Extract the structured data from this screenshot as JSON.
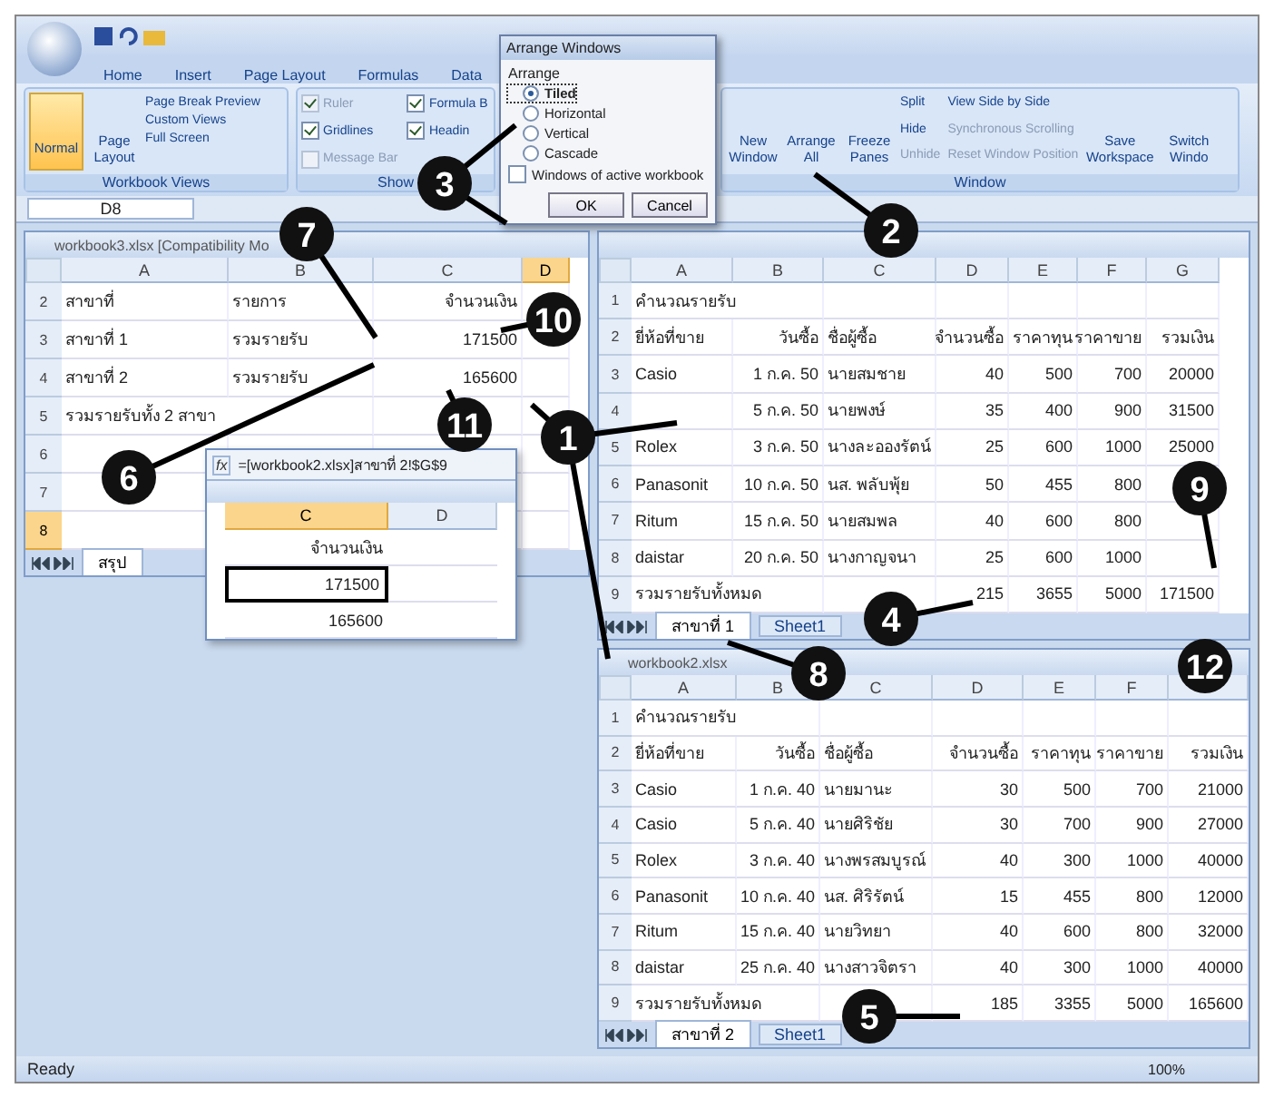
{
  "ribbon_tabs": [
    {
      "label": "Home",
      "selected": false
    },
    {
      "label": "Insert",
      "selected": false
    },
    {
      "label": "Page Layout",
      "selected": false
    },
    {
      "label": "Formulas",
      "selected": false
    },
    {
      "label": "Data",
      "selected": false
    }
  ],
  "workbook_views": {
    "label": "Workbook Views",
    "items": [
      {
        "label": "Normal",
        "selected": true
      },
      {
        "label": "Page Layout",
        "selected": false
      }
    ],
    "small": [
      "Page Break Preview",
      "Custom Views",
      "Full Screen"
    ]
  },
  "show_group": {
    "label": "Show",
    "items": [
      {
        "label": "Ruler",
        "checked": true,
        "disabled": true
      },
      {
        "label": "Gridlines",
        "checked": true,
        "disabled": false
      },
      {
        "label": "Message Bar",
        "checked": false,
        "disabled": true
      },
      {
        "label": "Formula B",
        "checked": true,
        "disabled": false
      },
      {
        "label": "Headin",
        "checked": true,
        "disabled": false
      }
    ]
  },
  "window_group": {
    "label": "Window",
    "large": [
      "New Window",
      "Arrange All",
      "Freeze Panes"
    ],
    "small": [
      {
        "label": "Split",
        "disabled": false
      },
      {
        "label": "Hide",
        "disabled": false
      },
      {
        "label": "Unhide",
        "disabled": true
      },
      {
        "label": "View Side by Side",
        "disabled": false
      },
      {
        "label": "Synchronous Scrolling",
        "disabled": true
      },
      {
        "label": "Reset Window Position",
        "disabled": true
      }
    ],
    "end": [
      "Save Workspace",
      "Switch Windo"
    ]
  },
  "name_box": "D8",
  "dialog": {
    "title": "Arrange Windows",
    "group": "Arrange",
    "options": [
      {
        "label": "Tiled",
        "selected": true
      },
      {
        "label": "Horizontal",
        "selected": false
      },
      {
        "label": "Vertical",
        "selected": false
      },
      {
        "label": "Cascade",
        "selected": false
      }
    ],
    "checkbox": {
      "label": "Windows of active workbook",
      "checked": false
    },
    "buttons": [
      "OK",
      "Cancel"
    ]
  },
  "sheets": [
    {
      "title": "workbook3.xlsx [Compatibility Mo",
      "columns": [
        {
          "label": "A",
          "selected": false
        },
        {
          "label": "B",
          "selected": false
        },
        {
          "label": "C",
          "selected": false
        },
        {
          "label": "D",
          "selected": true
        }
      ],
      "rows": [
        {
          "num": "2",
          "selected": false,
          "cells": {
            "A": "สาขาที่",
            "B": "รายการ",
            "C": "จำนวนเงิน"
          }
        },
        {
          "num": "3",
          "selected": false,
          "cells": {
            "A": "สาขาที่ 1",
            "B": "รวมรายรับ",
            "C": "171500"
          }
        },
        {
          "num": "4",
          "selected": false,
          "cells": {
            "A": "สาขาที่ 2",
            "B": "รวมรายรับ",
            "C": "165600"
          }
        },
        {
          "num": "5",
          "selected": false,
          "cells": {
            "A": "รวมรายรับทั้ง 2 สาขา"
          }
        },
        {
          "num": "6",
          "selected": false,
          "cells": {}
        },
        {
          "num": "7",
          "selected": false,
          "cells": {}
        },
        {
          "num": "8",
          "selected": true,
          "cells": {}
        }
      ],
      "tabs": [
        {
          "label": "สรุป",
          "selected": true
        }
      ]
    },
    {
      "columns": [
        {
          "label": "A",
          "selected": false
        },
        {
          "label": "B",
          "selected": false
        },
        {
          "label": "C",
          "selected": false
        },
        {
          "label": "D",
          "selected": false
        },
        {
          "label": "E",
          "selected": false
        },
        {
          "label": "F",
          "selected": false
        },
        {
          "label": "G",
          "selected": false
        }
      ],
      "rows": [
        {
          "num": "1",
          "selected": false,
          "cells": {
            "A": "คำนวณรายรับ"
          }
        },
        {
          "num": "2",
          "selected": false,
          "cells": {
            "A": "ยี่ห้อที่ขาย",
            "B": "วันซื้อ",
            "C": "ชื่อผู้ซื้อ",
            "D": "จำนวนซื้อ",
            "E": "ราคาทุน",
            "F": "ราคาขาย",
            "G": "รวมเงิน"
          }
        },
        {
          "num": "3",
          "selected": false,
          "cells": {
            "A": "Casio",
            "B": "1 ก.ค. 50",
            "C": "นายสมชาย",
            "D": "40",
            "E": "500",
            "F": "700",
            "G": "20000"
          }
        },
        {
          "num": "4",
          "selected": false,
          "cells": {
            "B": "5 ก.ค. 50",
            "C": "นายพงษ์",
            "D": "35",
            "E": "400",
            "F": "900",
            "G": "31500"
          }
        },
        {
          "num": "5",
          "selected": false,
          "cells": {
            "A": "Rolex",
            "B": "3 ก.ค. 50",
            "C": "นางละอองรัตน์",
            "D": "25",
            "E": "600",
            "F": "1000",
            "G": "25000"
          }
        },
        {
          "num": "6",
          "selected": false,
          "cells": {
            "A": "Panasonit",
            "B": "10 ก.ค. 50",
            "C": "นส. พลับพุ้ย",
            "D": "50",
            "E": "455",
            "F": "800"
          }
        },
        {
          "num": "7",
          "selected": false,
          "cells": {
            "A": "Ritum",
            "B": "15 ก.ค. 50",
            "C": "นายสมพล",
            "D": "40",
            "E": "600",
            "F": "800"
          }
        },
        {
          "num": "8",
          "selected": false,
          "cells": {
            "A": "daistar",
            "B": "20 ก.ค. 50",
            "C": "นางกาญจนา",
            "D": "25",
            "E": "600",
            "F": "1000"
          }
        },
        {
          "num": "9",
          "selected": false,
          "cells": {
            "A": "รวมรายรับทั้งหมด",
            "D": "215",
            "E": "3655",
            "F": "5000",
            "G": "171500"
          }
        }
      ],
      "tabs": [
        {
          "label": "สาขาที่ 1",
          "selected": true
        },
        {
          "label": "Sheet1",
          "selected": false
        }
      ]
    },
    {
      "title": "workbook2.xlsx",
      "columns": [
        {
          "label": "A",
          "selected": false
        },
        {
          "label": "B",
          "selected": false
        },
        {
          "label": "C",
          "selected": false
        },
        {
          "label": "D",
          "selected": false
        },
        {
          "label": "E",
          "selected": false
        },
        {
          "label": "F",
          "selected": false
        }
      ],
      "rows": [
        {
          "num": "1",
          "selected": false,
          "cells": {
            "A": "คำนวณรายรับ"
          }
        },
        {
          "num": "2",
          "selected": false,
          "cells": {
            "A": "ยี่ห้อที่ขาย",
            "B": "วันซื้อ",
            "C": "ชื่อผู้ซื้อ",
            "D": "จำนวนซื้อ",
            "E": "ราคาทุน",
            "F": "ราคาขาย",
            "G": "รวมเงิน"
          }
        },
        {
          "num": "3",
          "selected": false,
          "cells": {
            "A": "Casio",
            "B": "1 ก.ค. 40",
            "C": "นายมานะ",
            "D": "30",
            "E": "500",
            "F": "700",
            "G": "21000"
          }
        },
        {
          "num": "4",
          "selected": false,
          "cells": {
            "A": "Casio",
            "B": "5 ก.ค. 40",
            "C": "นายศิริชัย",
            "D": "30",
            "E": "700",
            "F": "900",
            "G": "27000"
          }
        },
        {
          "num": "5",
          "selected": false,
          "cells": {
            "A": "Rolex",
            "B": "3 ก.ค. 40",
            "C": "นางพรสมบูรณ์",
            "D": "40",
            "E": "300",
            "F": "1000",
            "G": "40000"
          }
        },
        {
          "num": "6",
          "selected": false,
          "cells": {
            "A": "Panasonit",
            "B": "10 ก.ค. 40",
            "C": "นส. ศิริรัตน์",
            "D": "15",
            "E": "455",
            "F": "800",
            "G": "12000"
          }
        },
        {
          "num": "7",
          "selected": false,
          "cells": {
            "A": "Ritum",
            "B": "15 ก.ค. 40",
            "C": "นายวิทยา",
            "D": "40",
            "E": "600",
            "F": "800",
            "G": "32000"
          }
        },
        {
          "num": "8",
          "selected": false,
          "cells": {
            "A": "daistar",
            "B": "25 ก.ค. 40",
            "C": "นางสาวจิตรา",
            "D": "40",
            "E": "300",
            "F": "1000",
            "G": "40000"
          }
        },
        {
          "num": "9",
          "selected": false,
          "cells": {
            "A": "รวมรายรับทั้งหมด",
            "D": "185",
            "E": "3355",
            "F": "5000",
            "G": "165600"
          }
        }
      ],
      "tabs": [
        {
          "label": "สาขาที่ 2",
          "selected": true
        },
        {
          "label": "Sheet1",
          "selected": false
        }
      ]
    }
  ],
  "mini_window": {
    "fx": "fx",
    "formula": "=[workbook2.xlsx]สาขาที่ 2!$G$9",
    "columns": [
      {
        "label": "C",
        "selected": true
      },
      {
        "label": "D",
        "selected": false
      }
    ],
    "rows": [
      {
        "value": "จำนวนเงิน",
        "selected": false
      },
      {
        "value": "171500",
        "selected": true
      },
      {
        "value": "165600",
        "selected": false
      }
    ]
  },
  "status_bar": {
    "text": "Ready",
    "zoom": "100%"
  },
  "callouts": [
    "1",
    "2",
    "3",
    "4",
    "5",
    "6",
    "7",
    "8",
    "9",
    "10",
    "11",
    "12"
  ]
}
